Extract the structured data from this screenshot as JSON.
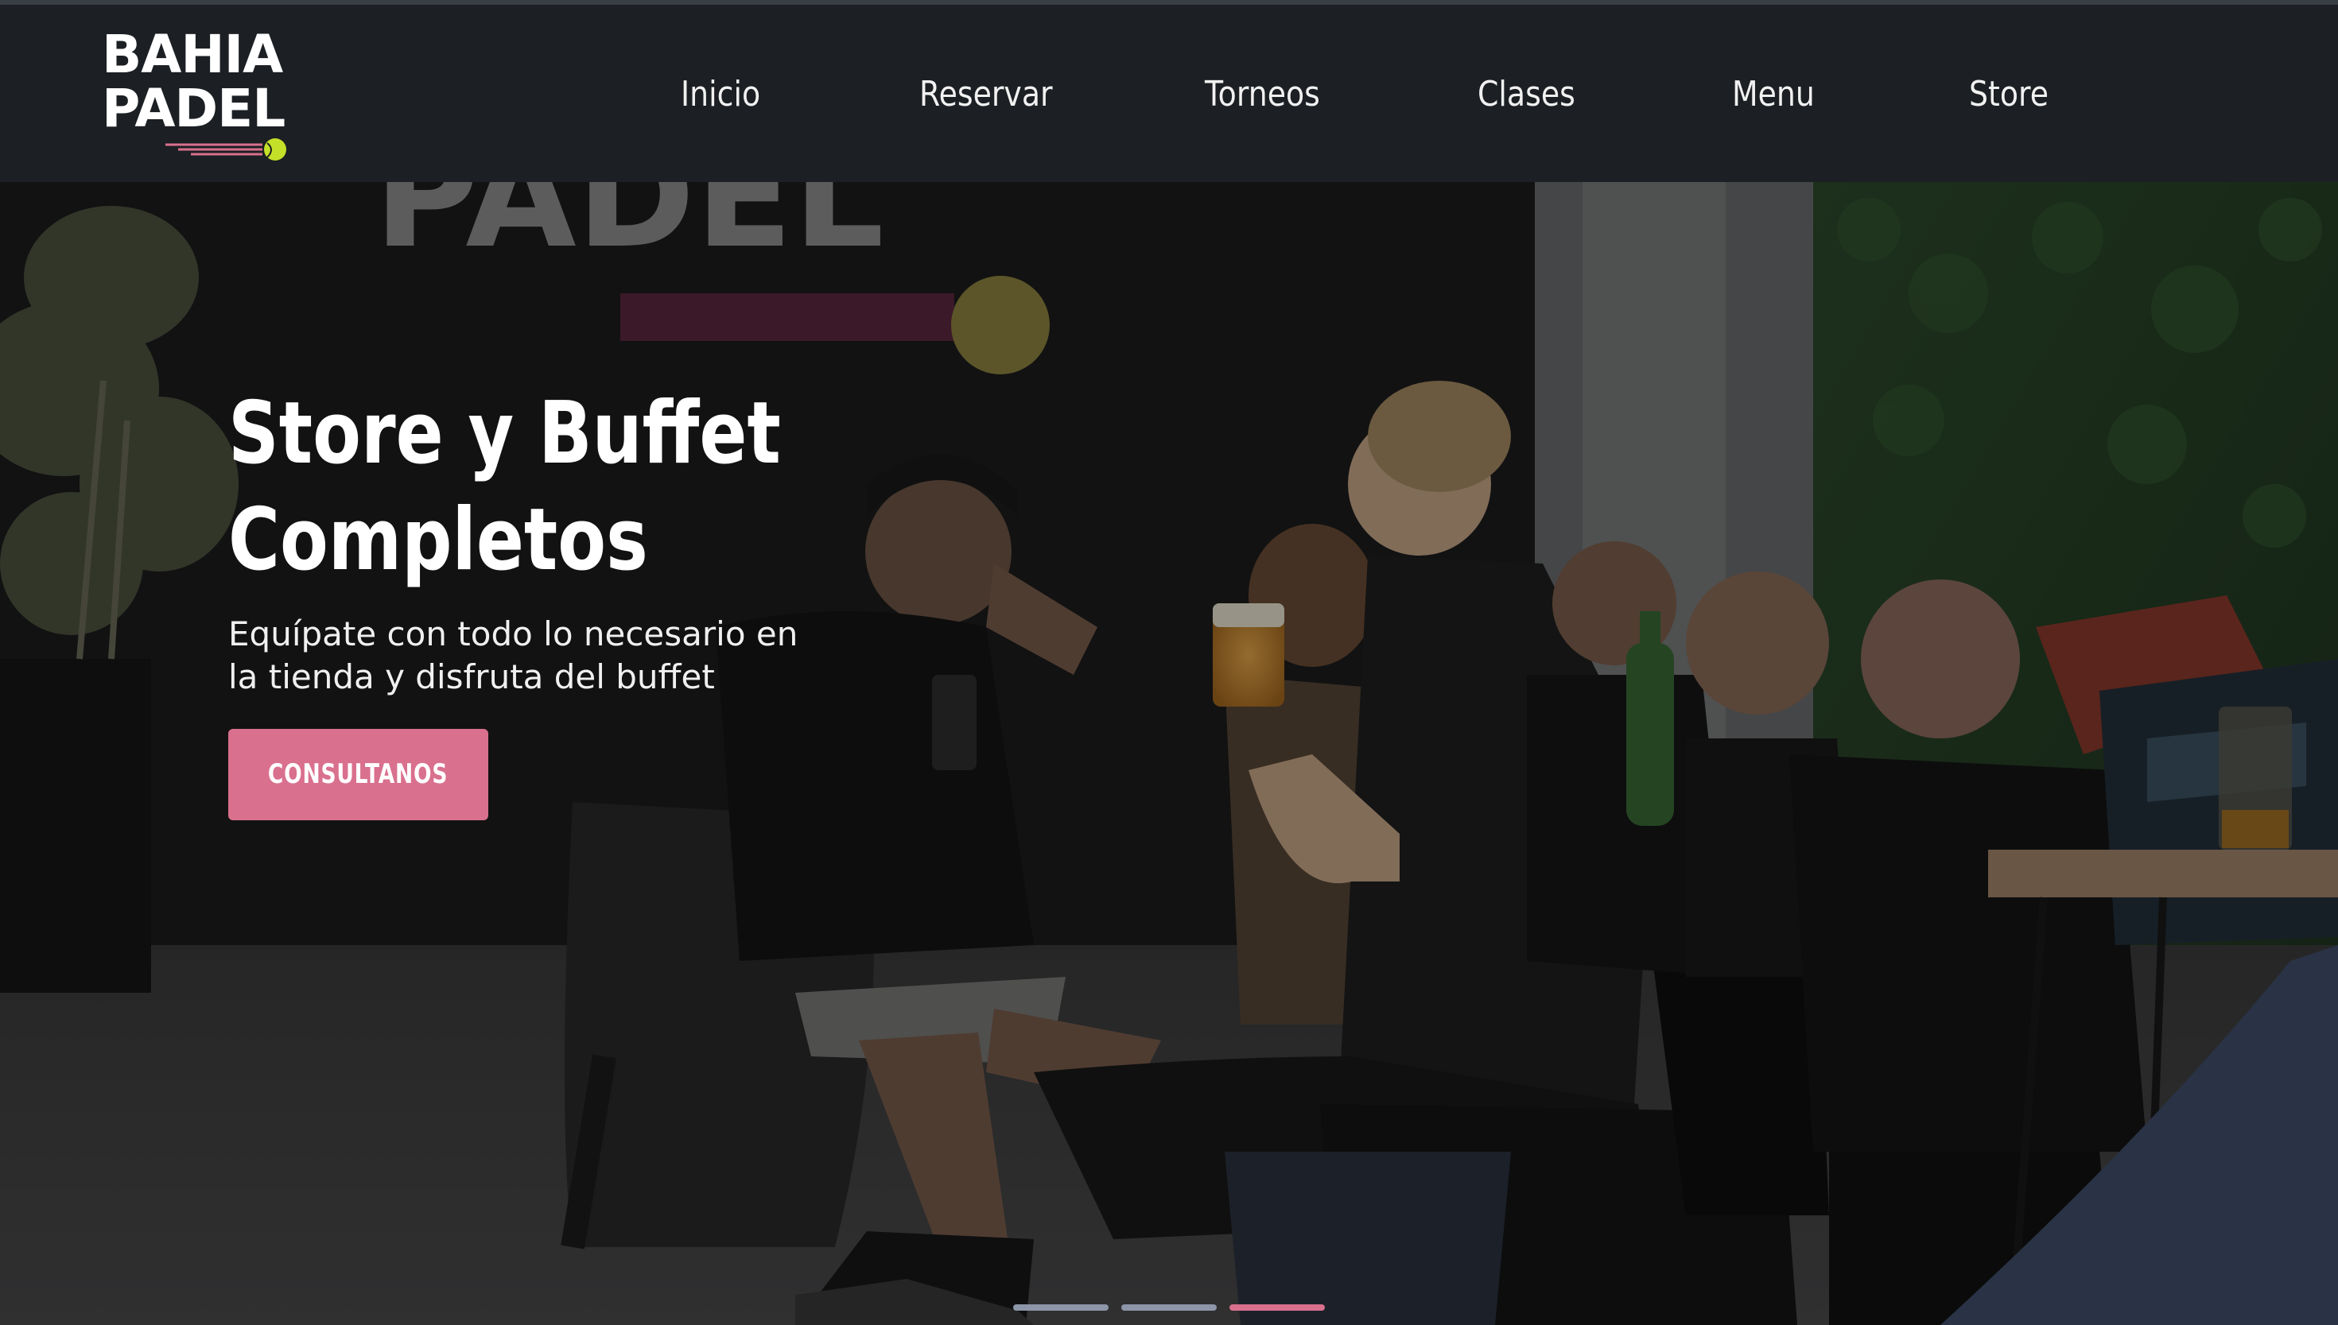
{
  "brand": {
    "line1": "BAHIA",
    "line2": "PADEL",
    "accent_color": "#d9708e",
    "ball_color": "#c5e028"
  },
  "nav": {
    "items": [
      {
        "label": "Inicio"
      },
      {
        "label": "Reservar"
      },
      {
        "label": "Torneos"
      },
      {
        "label": "Clases"
      },
      {
        "label": "Menu"
      },
      {
        "label": "Store"
      }
    ]
  },
  "hero": {
    "title_line1": "Store y Buffet",
    "title_line2": "Completos",
    "subtitle_line1": "Equípate con todo lo necesario en",
    "subtitle_line2": "la tienda y disfruta del buffet",
    "button_label": "CONSULTANOS",
    "background_text": "PADEL",
    "carousel": {
      "slides": 3,
      "active": 3
    }
  },
  "colors": {
    "header_bg": "#1c1f23",
    "button_bg": "#d9708e",
    "indicator_inactive": "#8d96a8",
    "indicator_active": "#d9708e"
  }
}
